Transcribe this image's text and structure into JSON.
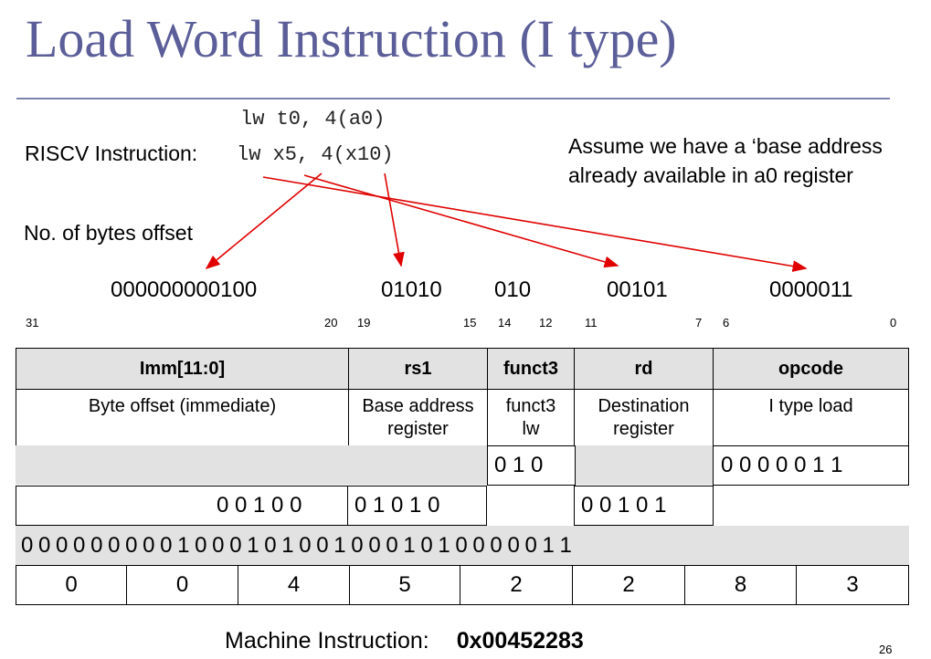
{
  "title": "Load Word Instruction (I type)",
  "asm_abi": "lw t0, 4(a0)",
  "riscv_label": "RISCV Instruction: ",
  "asm_x": "lw x5, 4(x10)",
  "assume_line1": "Assume we have a ‘base address",
  "assume_line2": "already available in a0 register",
  "offset_note": "No. of bytes offset",
  "field_bits": {
    "imm": "000000000100",
    "rs1": "01010",
    "funct3": "010",
    "rd": "00101",
    "opcode": "0000011"
  },
  "bit_positions": [
    "31",
    "20",
    "19",
    "15",
    "14",
    "12",
    "11",
    "7",
    "6",
    "0"
  ],
  "headers": [
    "Imm[11:0]",
    "rs1",
    "funct3",
    "rd",
    "opcode"
  ],
  "descriptions": [
    "Byte offset (immediate)",
    "Base address register",
    "funct3 lw",
    "Destination register",
    "I type load"
  ],
  "row_funct3": "0 1 0",
  "row_opcode": "0 0 0 0 0 1 1",
  "row_imm": "0 0 1 0 0",
  "row_rs1": "0 1 0 1 0",
  "row_rd": "0 0 1 0 1",
  "full_bits": "0 0 0 0 0 0 0 0 0 1 0 0 0 1 0 1 0 0 1 0 0 0 1 0 1 0 0 0 0 0 1 1",
  "hex_digits": [
    "0",
    "0",
    "4",
    "5",
    "2",
    "2",
    "8",
    "3"
  ],
  "machine_label": "Machine Instruction:",
  "machine_value": "0x00452283",
  "page_number": "26",
  "colors": {
    "title": "#5b5e98",
    "arrow": "#e00000",
    "shade": "#e2e2e2"
  }
}
